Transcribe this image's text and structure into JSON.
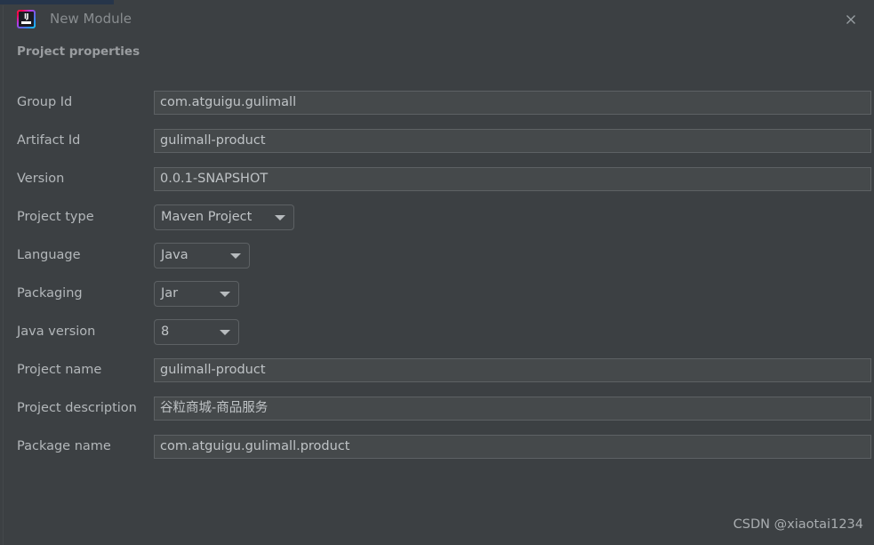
{
  "window": {
    "title": "New Module",
    "app_icon": "intellij-idea-icon",
    "close_icon": "close-icon",
    "accent_color": "#26354a"
  },
  "section": {
    "heading": "Project properties"
  },
  "form": {
    "fields": [
      {
        "label": "Group Id",
        "type": "text",
        "value": "com.atguigu.gulimall"
      },
      {
        "label": "Artifact Id",
        "type": "text",
        "value": "gulimall-product"
      },
      {
        "label": "Version",
        "type": "text",
        "value": "0.0.1-SNAPSHOT"
      },
      {
        "label": "Project type",
        "type": "combo",
        "value": "Maven Project"
      },
      {
        "label": "Language",
        "type": "combo",
        "value": "Java"
      },
      {
        "label": "Packaging",
        "type": "combo",
        "value": "Jar"
      },
      {
        "label": "Java version",
        "type": "combo",
        "value": "8"
      },
      {
        "label": "Project name",
        "type": "text",
        "value": "gulimall-product"
      },
      {
        "label": "Project description",
        "type": "text",
        "value": "谷粒商城-商品服务"
      },
      {
        "label": "Package name",
        "type": "text",
        "value": "com.atguigu.gulimall.product"
      }
    ]
  },
  "watermark": {
    "text": "CSDN @xiaotai1234"
  }
}
